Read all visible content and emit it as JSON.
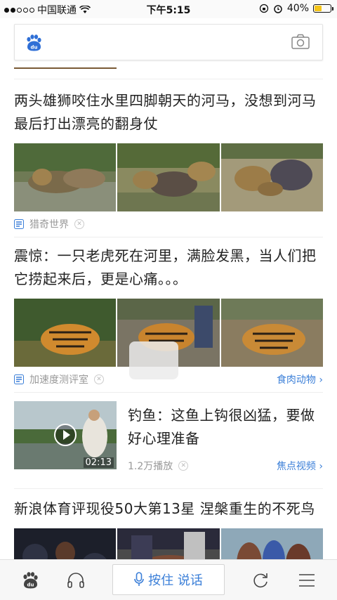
{
  "status_bar": {
    "carrier": "中国联通",
    "time": "下午5:15",
    "battery": "40%",
    "battery_level": 0.4,
    "signal_bars": 2
  },
  "search": {
    "logo": "baidu-paw-icon",
    "camera_icon": "camera-icon"
  },
  "feed": {
    "articles": [
      {
        "title": "两头雄狮咬住水里四脚朝天的河马，没想到河马最后打出漂亮的翻身仗",
        "source": "猎奇世界",
        "tag": ""
      },
      {
        "title": "震惊：一只老虎死在河里，满脸发黑，当人们把它捞起来后，更是心痛。。。",
        "source": "加速度测评室",
        "tag": "食肉动物"
      }
    ],
    "video": {
      "title": "钓鱼：这鱼上钩很凶猛，要做好心理准备",
      "plays": "1.2万播放",
      "duration": "02:13",
      "tag": "焦点视频"
    },
    "article3": {
      "title": "新浪体育评现役50大第13星 涅槃重生的不死鸟"
    }
  },
  "bottom_bar": {
    "voice_label": "按住 说话"
  },
  "colors": {
    "accent": "#3b7fd8",
    "battery": "#f5c518"
  }
}
